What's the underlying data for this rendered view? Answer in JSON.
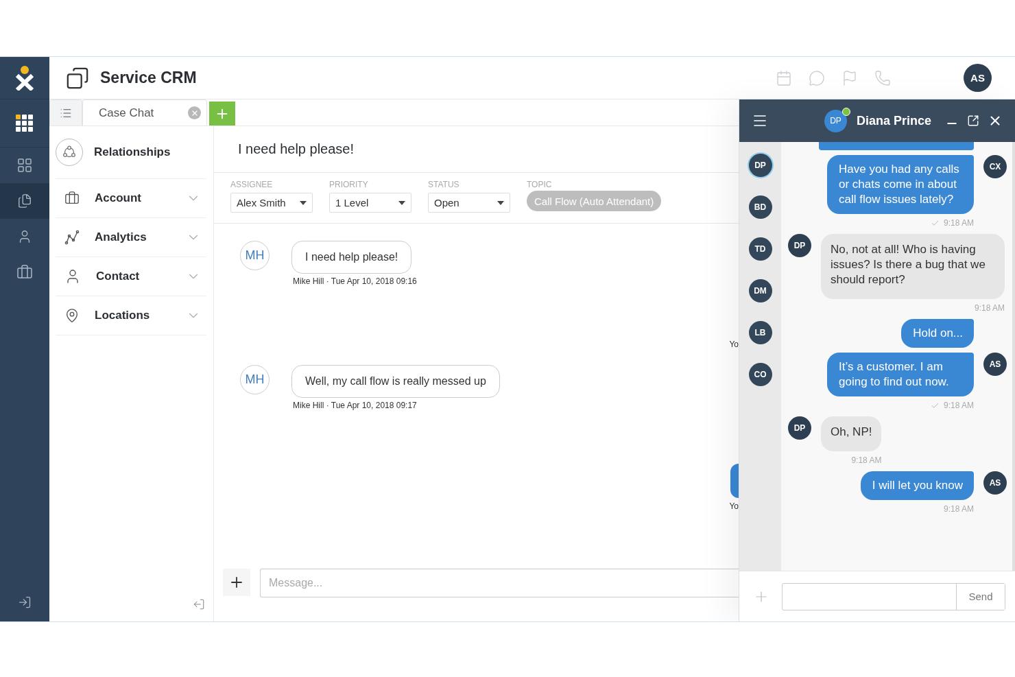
{
  "nav": {
    "items": [
      {
        "kind": "grid",
        "selected": false
      },
      {
        "kind": "apps",
        "selected": false
      },
      {
        "kind": "documents",
        "selected": true
      },
      {
        "kind": "contact",
        "selected": false
      },
      {
        "kind": "briefcase",
        "selected": false
      }
    ]
  },
  "header": {
    "title": "Service CRM",
    "avatar": "AS"
  },
  "tabs": [
    {
      "label": "Case Chat",
      "selected": true
    }
  ],
  "sidebar": {
    "heading": {
      "label": "Relationships"
    },
    "items": [
      {
        "label": "Account",
        "kind": "account",
        "expanded": false
      },
      {
        "label": "Analytics",
        "kind": "analytics",
        "expanded": false
      },
      {
        "label": "Contact",
        "kind": "contact",
        "expanded": false
      },
      {
        "label": "Locations",
        "kind": "locations",
        "expanded": false
      }
    ]
  },
  "case": {
    "title": "I need help please!",
    "fields": [
      {
        "label": "ASSIGNEE",
        "value": "Alex Smith",
        "kind": "select"
      },
      {
        "label": "PRIORITY",
        "value": "1 Level",
        "kind": "select"
      },
      {
        "label": "STATUS",
        "value": "Open",
        "kind": "select"
      },
      {
        "label": "TOPIC",
        "value": "Call Flow (Auto Attendant)",
        "kind": "chip"
      }
    ],
    "messages": [
      {
        "kind": "incoming",
        "initials": "MH",
        "text": "I need help please!",
        "meta": "Mike Hill · Tue Apr 10, 2018 09:16"
      },
      {
        "kind": "outgoing",
        "bubble": false,
        "meta": "Yo"
      },
      {
        "kind": "incoming",
        "initials": "MH",
        "text": "Well, my call flow is really messed up",
        "meta": "Mike Hill · Tue Apr 10, 2018 09:17"
      },
      {
        "kind": "outgoing",
        "bubble": true,
        "meta": "Yo"
      }
    ],
    "composer": {
      "placeholder": "Message..."
    }
  },
  "chat_panel": {
    "title": "Diana Prince",
    "avatar": "DP",
    "online": true,
    "contacts": [
      {
        "initials": "DP",
        "selected": true
      },
      {
        "initials": "BD",
        "selected": false
      },
      {
        "initials": "TD",
        "selected": false
      },
      {
        "initials": "DM",
        "selected": false
      },
      {
        "initials": "LB",
        "selected": false
      },
      {
        "initials": "CO",
        "selected": false
      }
    ],
    "messages": [
      {
        "kind": "cut"
      },
      {
        "kind": "out",
        "avatar": "CX",
        "text": "Have you had any calls or chats come in about call flow issues lately?",
        "time": "9:18 AM",
        "read": true
      },
      {
        "kind": "in",
        "avatar": "DP",
        "text": "No, not at all! Who is having issues? Is there a bug that we should report?",
        "time": "9:18 AM"
      },
      {
        "kind": "out",
        "text": "Hold on..."
      },
      {
        "kind": "out",
        "avatar": "AS",
        "text": "It’s a customer. I am going to find out now.",
        "time": "9:18 AM",
        "read": true
      },
      {
        "kind": "in",
        "avatar": "DP",
        "text": "Oh, NP!",
        "time": "9:18 AM"
      },
      {
        "kind": "out",
        "avatar": "AS",
        "text": "I will let you know",
        "time": "9:18 AM",
        "read": false
      }
    ],
    "composer": {
      "send": "Send"
    }
  }
}
